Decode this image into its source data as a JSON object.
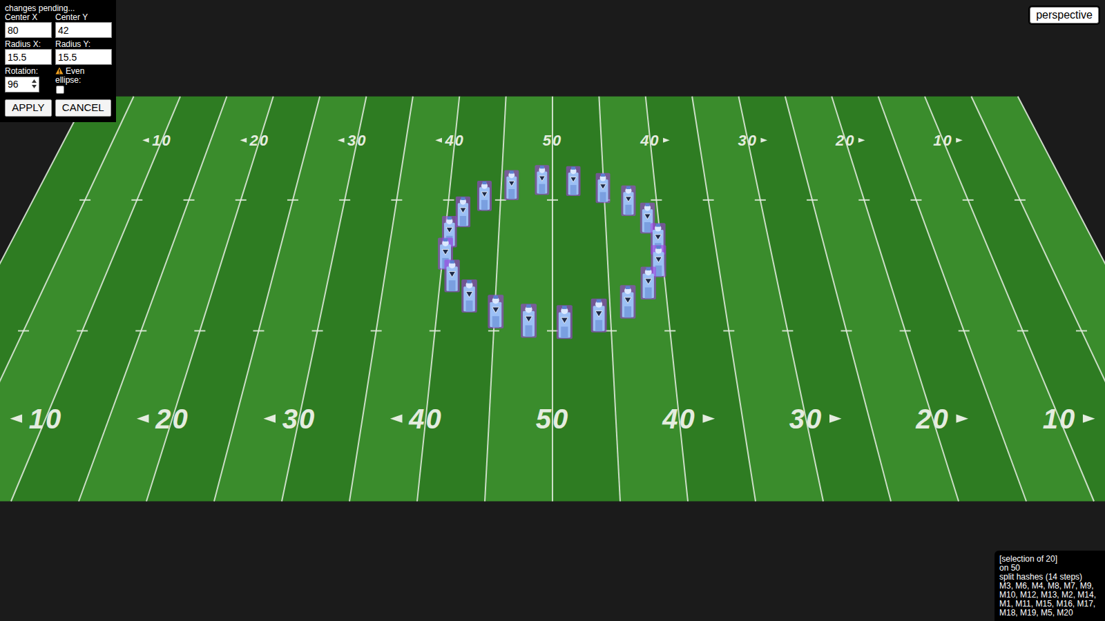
{
  "editor": {
    "status": "changes pending...",
    "fields": [
      {
        "label": "Center X",
        "value": "80"
      },
      {
        "label": "Center Y",
        "value": "42"
      },
      {
        "label": "Radius X:",
        "value": "15.5"
      },
      {
        "label": "Radius Y:",
        "value": "15.5"
      },
      {
        "label": "Rotation:",
        "value": "96"
      }
    ],
    "even_ellipse": {
      "label": "Even ellipse:",
      "checked": false
    },
    "buttons": [
      "APPLY",
      "CANCEL"
    ]
  },
  "view_button": "perspective",
  "field": {
    "back_numbers": [
      "10",
      "20",
      "30",
      "40",
      "50",
      "40",
      "30",
      "20",
      "10"
    ],
    "front_numbers": [
      "10",
      "20",
      "30",
      "40",
      "50",
      "40",
      "30",
      "20",
      "10"
    ]
  },
  "marchers": [
    {
      "selected": true
    },
    {
      "selected": true
    },
    {
      "selected": true
    },
    {
      "selected": true
    },
    {
      "selected": true
    },
    {
      "selected": true
    },
    {
      "selected": true
    },
    {
      "selected": true
    },
    {
      "selected": true
    },
    {
      "selected": true
    },
    {
      "selected": true
    },
    {
      "selected": true
    },
    {
      "selected": true
    },
    {
      "selected": true
    },
    {
      "selected": true
    },
    {
      "selected": true
    },
    {
      "selected": true
    },
    {
      "selected": true
    },
    {
      "selected": true
    },
    {
      "selected": true
    }
  ],
  "selection": {
    "lines": [
      "[selection of 20]",
      "on 50",
      "split hashes (14 steps)",
      "M3, M6, M4, M8, M7, M9, M10, M12, M13, M2, M14, M1, M11, M15, M16, M17, M18, M19, M5, M20"
    ]
  }
}
